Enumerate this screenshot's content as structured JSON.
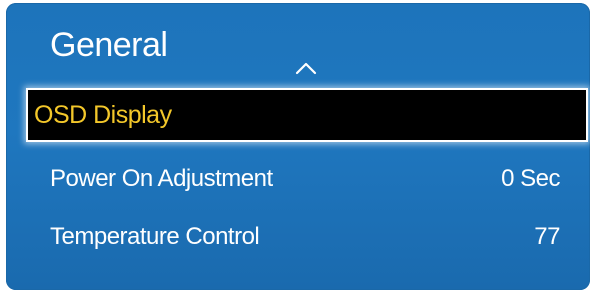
{
  "menu": {
    "title": "General",
    "scroll_up_icon": "chevron-up-icon",
    "items": [
      {
        "label": "OSD Display",
        "value": "",
        "selected": true
      },
      {
        "label": "Power On Adjustment",
        "value": "0 Sec",
        "selected": false
      },
      {
        "label": "Temperature Control",
        "value": "77",
        "selected": false
      }
    ]
  },
  "colors": {
    "panel_background": "#1f77bf",
    "selected_text": "#f3c72a",
    "selected_background": "#000000",
    "text": "#ffffff"
  }
}
